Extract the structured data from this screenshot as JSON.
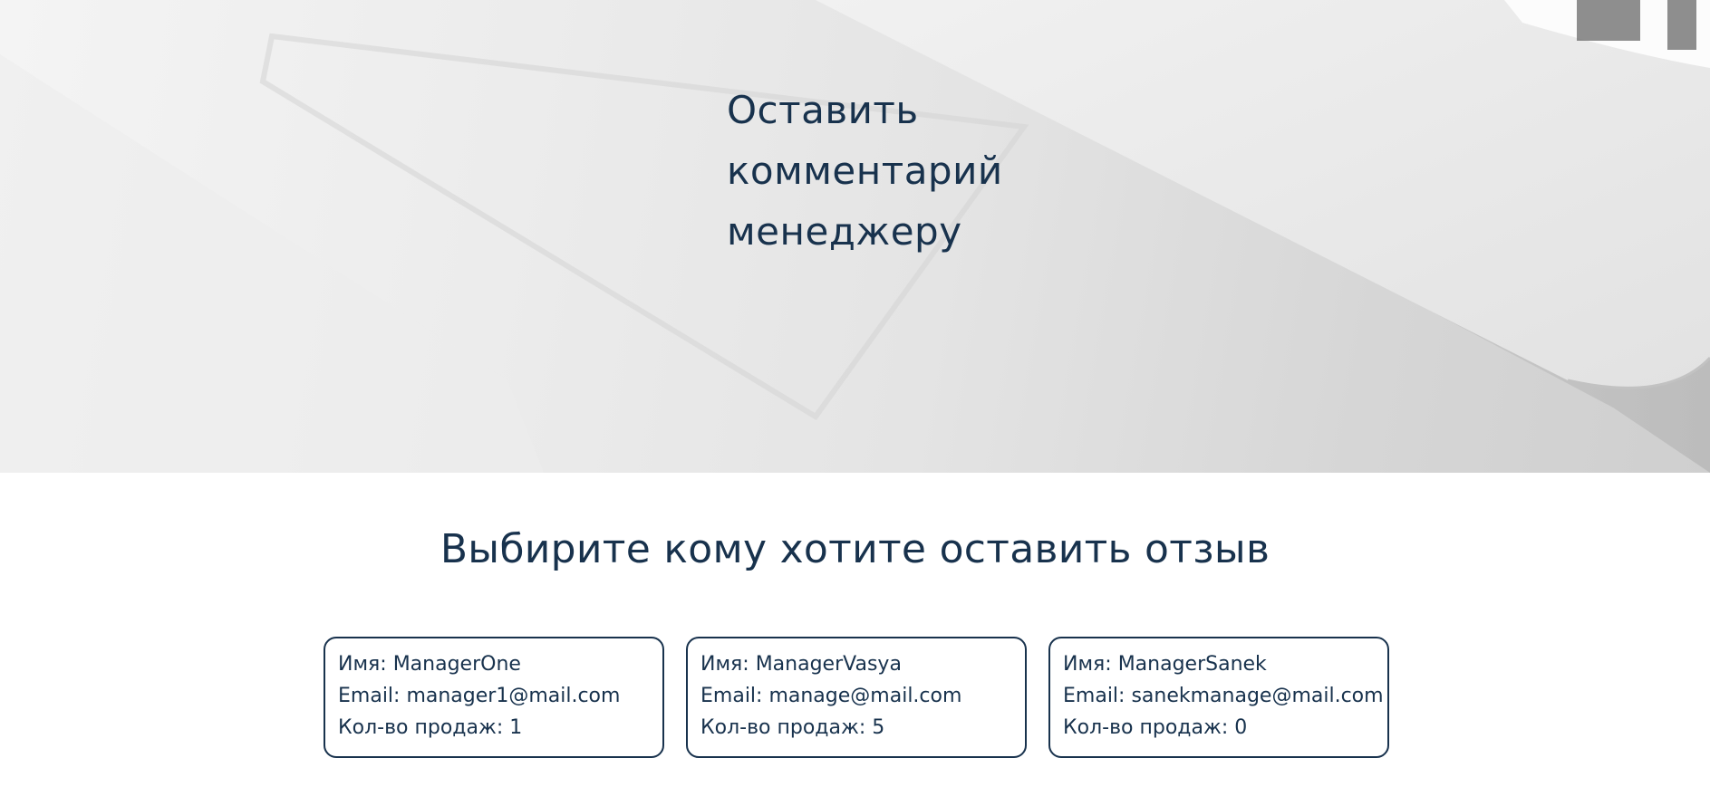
{
  "hero": {
    "title_lines": [
      "Оставить",
      "комментарий",
      "менеджеру"
    ]
  },
  "section": {
    "title": "Выбирите кому хотите оставить отзыв"
  },
  "managers": [
    {
      "name_label": "Имя:",
      "name": "ManagerOne",
      "email_label": "Email:",
      "email": "manager1@mail.com",
      "sales_label": "Кол-во продаж:",
      "sales": "1"
    },
    {
      "name_label": "Имя:",
      "name": "ManagerVasya",
      "email_label": "Email:",
      "email": "manage@mail.com",
      "sales_label": "Кол-во продаж:",
      "sales": "5"
    },
    {
      "name_label": "Имя:",
      "name": "ManagerSanek",
      "email_label": "Email:",
      "email": "sanekmanage@mail.com",
      "sales_label": "Кол-во продаж:",
      "sales": "0"
    }
  ],
  "colors": {
    "primary_text": "#18324d",
    "card_border": "#18324d",
    "page_background": "#ffffff"
  }
}
